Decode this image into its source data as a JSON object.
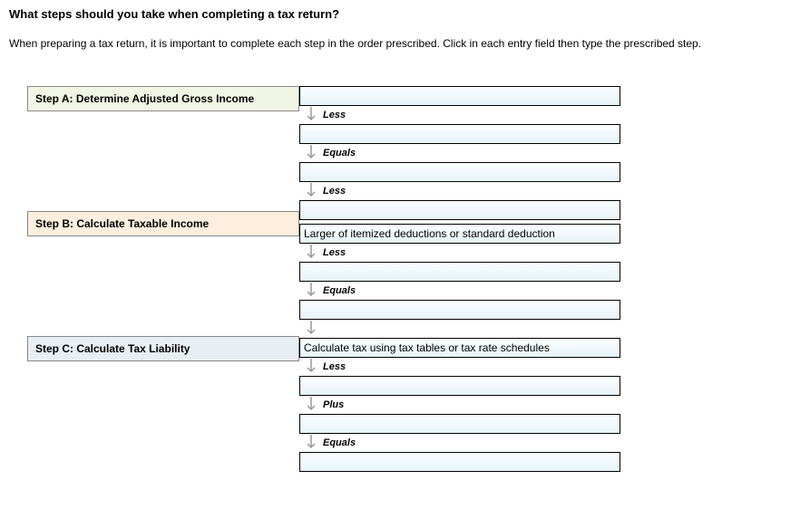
{
  "title": "What steps should you take when completing a tax return?",
  "intro": "When preparing a tax return, it is important to complete each step in the order prescribed. Click in each entry field then type the prescribed step.",
  "steps": {
    "a": "Step A: Determine Adjusted Gross Income",
    "b": "Step B: Calculate Taxable Income",
    "c": "Step C: Calculate Tax Liability"
  },
  "connectors": {
    "less": "Less",
    "equals": "Equals",
    "plus": "Plus"
  },
  "fields": {
    "f1": "",
    "f2": "",
    "f3": "",
    "f4": "",
    "f5": "Larger of itemized deductions or standard deduction",
    "f6": "",
    "f7": "",
    "f8": "Calculate tax using tax tables or tax rate schedules",
    "f9": "",
    "f10": "",
    "f11": ""
  }
}
